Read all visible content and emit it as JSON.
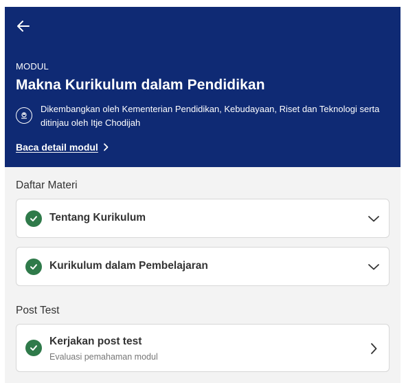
{
  "header": {
    "back_icon": "arrow-left-icon",
    "eyebrow": "MODUL",
    "title": "Makna Kurikulum dalam Pendidikan",
    "developer_text": "Dikembangkan oleh Kementerian Pendidikan, Kebudayaan, Riset dan Teknologi serta ditinjau oleh Itje Chodijah",
    "detail_link": "Baca detail modul",
    "colors": {
      "background": "#0f2a74",
      "text": "#ffffff"
    }
  },
  "materials": {
    "heading": "Daftar Materi",
    "items": [
      {
        "label": "Tentang Kurikulum",
        "status": "completed",
        "icon": "chevron-down-icon"
      },
      {
        "label": "Kurikulum dalam Pembelajaran",
        "status": "completed",
        "icon": "chevron-down-icon"
      }
    ]
  },
  "post_test": {
    "heading": "Post Test",
    "item": {
      "label": "Kerjakan post test",
      "subtitle": "Evaluasi pemahaman modul",
      "status": "completed",
      "icon": "chevron-right-icon"
    }
  },
  "colors": {
    "check": "#2f7a4a",
    "page_background": "#f3f3f3",
    "card_border": "#d7d7d7"
  }
}
